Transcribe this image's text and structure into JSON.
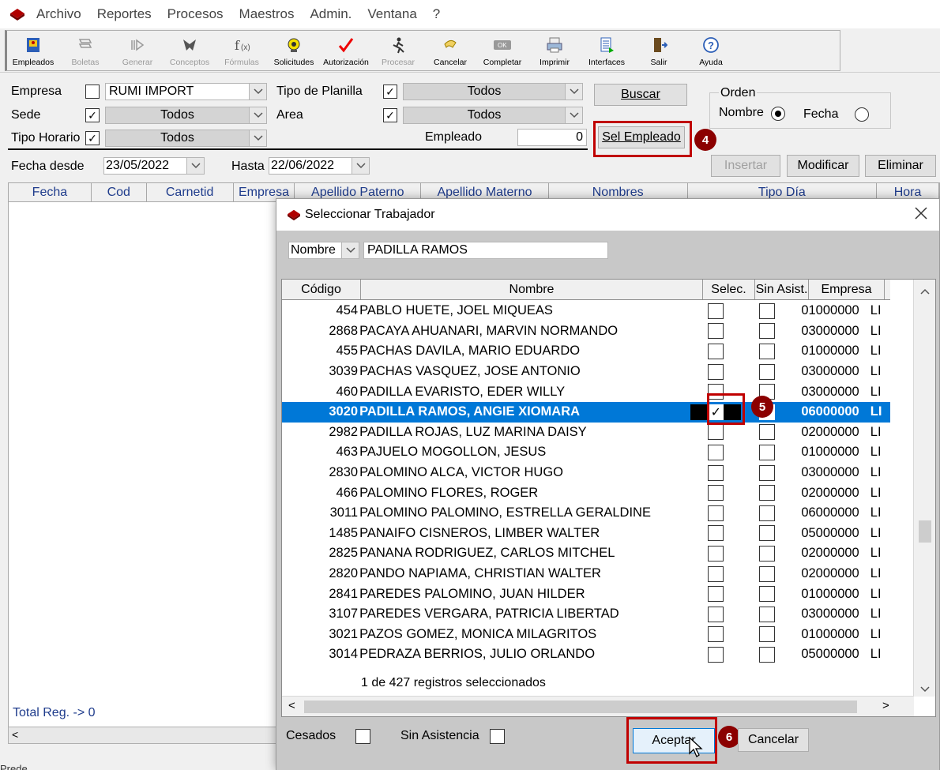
{
  "menu": [
    "Archivo",
    "Reportes",
    "Procesos",
    "Maestros",
    "Admin.",
    "Ventana",
    "?"
  ],
  "toolbar": [
    {
      "label": "Empleados",
      "icon": "employees-icon",
      "enabled": true
    },
    {
      "label": "Boletas",
      "icon": "payslip-icon",
      "enabled": false
    },
    {
      "label": "Generar",
      "icon": "generate-icon",
      "enabled": false
    },
    {
      "label": "Conceptos",
      "icon": "concepts-icon",
      "enabled": false
    },
    {
      "label": "Fórmulas",
      "icon": "formula-icon",
      "enabled": false
    },
    {
      "label": "Solicitudes",
      "icon": "requests-icon",
      "enabled": true
    },
    {
      "label": "Autorización",
      "icon": "authorize-icon",
      "enabled": true
    },
    {
      "label": "Procesar",
      "icon": "process-icon",
      "enabled": false
    },
    {
      "label": "Cancelar",
      "icon": "cancel-icon",
      "enabled": true
    },
    {
      "label": "Completar",
      "icon": "complete-icon",
      "enabled": true
    },
    {
      "label": "Imprimir",
      "icon": "print-icon",
      "enabled": true
    },
    {
      "label": "Interfaces",
      "icon": "interfaces-icon",
      "enabled": true
    },
    {
      "label": "Salir",
      "icon": "exit-icon",
      "enabled": true
    },
    {
      "label": "Ayuda",
      "icon": "help-icon",
      "enabled": true
    }
  ],
  "filters": {
    "empresa_label": "Empresa",
    "empresa_value": "RUMI IMPORT",
    "sede_label": "Sede",
    "sede_value": "Todos",
    "tipo_horario_label": "Tipo Horario",
    "tipo_horario_value": "Todos",
    "tipo_planilla_label": "Tipo de Planilla",
    "tipo_planilla_value": "Todos",
    "area_label": "Area",
    "area_value": "Todos",
    "empleado_label": "Empleado",
    "empleado_value": "0",
    "buscar": "Buscar",
    "sel_empleado": "Sel Empleado",
    "orden_label": "Orden",
    "orden_nombre": "Nombre",
    "orden_fecha": "Fecha",
    "fecha_desde_label": "Fecha desde",
    "fecha_desde": "23/05/2022",
    "hasta_label": "Hasta",
    "hasta": "22/06/2022",
    "insertar": "Insertar",
    "modificar": "Modificar",
    "eliminar": "Eliminar"
  },
  "main_columns": [
    "Fecha",
    "Cod",
    "Carnetid",
    "Empresa",
    "Apellido Paterno",
    "Apellido Materno",
    "Nombres",
    "Tipo Día",
    "Hora"
  ],
  "total_reg": "Total Reg. -> 0",
  "status_text": "Prede",
  "badges": {
    "b4": "4",
    "b5": "5",
    "b6": "6"
  },
  "dialog": {
    "title": "Seleccionar Trabajador",
    "search_field": "Nombre",
    "search_value": "PADILLA RAMOS",
    "columns": [
      "Código",
      "Nombre",
      "Selec.",
      "Sin Asist.",
      "Empresa"
    ],
    "rows": [
      {
        "code": "454",
        "name": "PABLO HUETE, JOEL  MIQUEAS",
        "sel": false,
        "sin": false,
        "emp": "01000000",
        "ext": "LI"
      },
      {
        "code": "2868",
        "name": "PACAYA AHUANARI, MARVIN NORMANDO",
        "sel": false,
        "sin": false,
        "emp": "03000000",
        "ext": "LI"
      },
      {
        "code": "455",
        "name": "PACHAS DAVILA, MARIO  EDUARDO",
        "sel": false,
        "sin": false,
        "emp": "01000000",
        "ext": "LI"
      },
      {
        "code": "3039",
        "name": "PACHAS VASQUEZ, JOSE ANTONIO",
        "sel": false,
        "sin": false,
        "emp": "03000000",
        "ext": "LI"
      },
      {
        "code": "460",
        "name": "PADILLA EVARISTO, EDER  WILLY",
        "sel": false,
        "sin": false,
        "emp": "03000000",
        "ext": "LI"
      },
      {
        "code": "3020",
        "name": "PADILLA RAMOS, ANGIE XIOMARA",
        "sel": true,
        "sin": false,
        "emp": "06000000",
        "ext": "LI",
        "selected": true
      },
      {
        "code": "2982",
        "name": "PADILLA ROJAS, LUZ MARINA DAISY",
        "sel": false,
        "sin": false,
        "emp": "02000000",
        "ext": "LI"
      },
      {
        "code": "463",
        "name": "PAJUELO MOGOLLON, JESUS",
        "sel": false,
        "sin": false,
        "emp": "01000000",
        "ext": "LI"
      },
      {
        "code": "2830",
        "name": "PALOMINO ALCA, VICTOR HUGO",
        "sel": false,
        "sin": false,
        "emp": "03000000",
        "ext": "LI"
      },
      {
        "code": "466",
        "name": "PALOMINO FLORES, ROGER",
        "sel": false,
        "sin": false,
        "emp": "02000000",
        "ext": "LI"
      },
      {
        "code": "3011",
        "name": "PALOMINO PALOMINO, ESTRELLA GERALDINE",
        "sel": false,
        "sin": false,
        "emp": "06000000",
        "ext": "LI"
      },
      {
        "code": "1485",
        "name": "PANAIFO CISNEROS, LIMBER WALTER",
        "sel": false,
        "sin": false,
        "emp": "05000000",
        "ext": "LI"
      },
      {
        "code": "2825",
        "name": "PANANA RODRIGUEZ, CARLOS MITCHEL",
        "sel": false,
        "sin": false,
        "emp": "02000000",
        "ext": "LI"
      },
      {
        "code": "2820",
        "name": "PANDO NAPIAMA, CHRISTIAN WALTER",
        "sel": false,
        "sin": false,
        "emp": "02000000",
        "ext": "LI"
      },
      {
        "code": "2841",
        "name": "PAREDES PALOMINO, JUAN HILDER",
        "sel": false,
        "sin": false,
        "emp": "01000000",
        "ext": "LI"
      },
      {
        "code": "3107",
        "name": "PAREDES VERGARA, PATRICIA LIBERTAD",
        "sel": false,
        "sin": false,
        "emp": "03000000",
        "ext": "LI"
      },
      {
        "code": "3021",
        "name": "PAZOS GOMEZ, MONICA MILAGRITOS",
        "sel": false,
        "sin": false,
        "emp": "01000000",
        "ext": "LI"
      },
      {
        "code": "3014",
        "name": "PEDRAZA BERRIOS, JULIO ORLANDO",
        "sel": false,
        "sin": false,
        "emp": "05000000",
        "ext": "LI"
      }
    ],
    "records_text": "1 de 427 registros seleccionados",
    "cesados_label": "Cesados",
    "sin_asistencia_label": "Sin Asistencia",
    "aceptar": "Aceptar",
    "cancelar": "Cancelar"
  },
  "colors": {
    "selection": "#0078d7",
    "highlight_box": "#c00000",
    "badge": "#8b0000"
  }
}
